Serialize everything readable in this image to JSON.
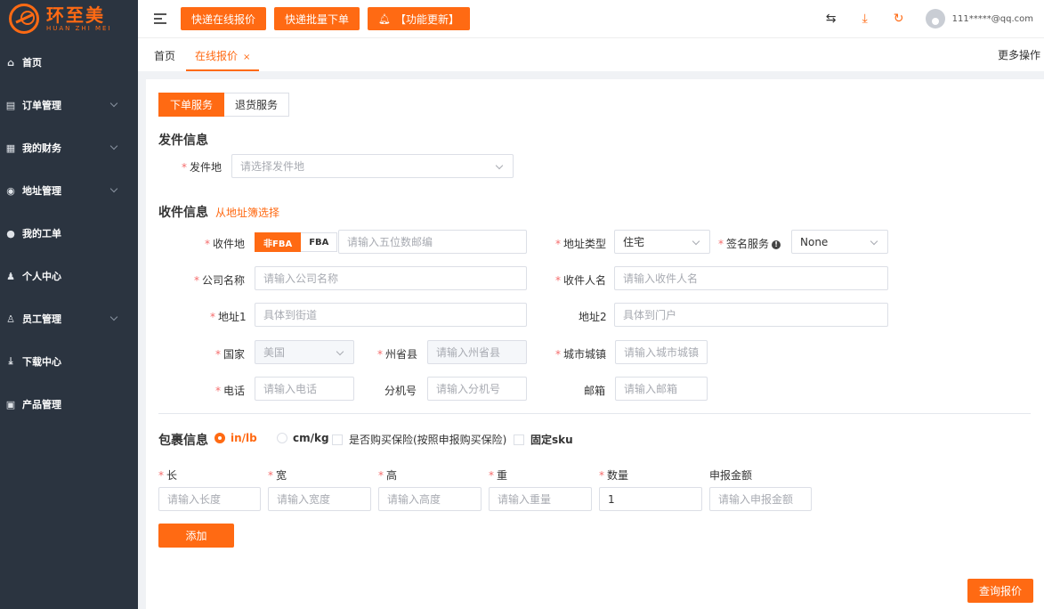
{
  "logo": {
    "cn": "环至美",
    "en": "HUAN ZHI MEI"
  },
  "sidebar": {
    "items": [
      {
        "label": "首页",
        "icon": "home-icon",
        "expandable": false
      },
      {
        "label": "订单管理",
        "icon": "order-icon",
        "expandable": true
      },
      {
        "label": "我的财务",
        "icon": "finance-icon",
        "expandable": true
      },
      {
        "label": "地址管理",
        "icon": "location-icon",
        "expandable": true
      },
      {
        "label": "我的工单",
        "icon": "ticket-icon",
        "expandable": false
      },
      {
        "label": "个人中心",
        "icon": "user-icon",
        "expandable": false
      },
      {
        "label": "员工管理",
        "icon": "staff-icon",
        "expandable": true
      },
      {
        "label": "下载中心",
        "icon": "download-icon",
        "expandable": false
      },
      {
        "label": "产品管理",
        "icon": "product-icon",
        "expandable": false
      }
    ]
  },
  "header": {
    "quick_quote": "快递在线报价",
    "bulk_order": "快递批量下单",
    "feature_update": "【功能更新】",
    "user": "111*****@qq.com"
  },
  "tabs": {
    "home": "首页",
    "active": "在线报价",
    "close": "×",
    "more": "更多操作"
  },
  "service": {
    "order": "下单服务",
    "return": "退货服务"
  },
  "sender": {
    "title": "发件信息",
    "origin_label": "发件地",
    "origin_placeholder": "请选择发件地"
  },
  "receiver": {
    "title": "收件信息",
    "pick_link": "从地址簿选择",
    "dest_label": "收件地",
    "non_fba": "非FBA",
    "fba": "FBA",
    "zip_placeholder": "请输入五位数邮编",
    "addr_type_label": "地址类型",
    "addr_type_value": "住宅",
    "sign_label": "签名服务",
    "sign_value": "None",
    "company_label": "公司名称",
    "company_placeholder": "请输入公司名称",
    "name_label": "收件人名",
    "name_placeholder": "请输入收件人名",
    "addr1_label": "地址1",
    "addr1_placeholder": "具体到街道",
    "addr2_label": "地址2",
    "addr2_placeholder": "具体到门户",
    "country_label": "国家",
    "country_value": "美国",
    "state_label": "州省县",
    "state_placeholder": "请输入州省县",
    "city_label": "城市城镇",
    "city_placeholder": "请输入城市城镇",
    "phone_label": "电话",
    "phone_placeholder": "请输入电话",
    "ext_label": "分机号",
    "ext_placeholder": "请输入分机号",
    "email_label": "邮箱",
    "email_placeholder": "请输入邮箱"
  },
  "package": {
    "title": "包裹信息",
    "unit_inlb": "in/lb",
    "unit_cmkg": "cm/kg",
    "insurance": "是否购买保险(按照申报购买保险)",
    "fixed_sku": "固定sku",
    "length_label": "长",
    "length_placeholder": "请输入长度",
    "width_label": "宽",
    "width_placeholder": "请输入宽度",
    "height_label": "高",
    "height_placeholder": "请输入高度",
    "weight_label": "重",
    "weight_placeholder": "请输入重量",
    "qty_label": "数量",
    "qty_value": "1",
    "declared_label": "申报金额",
    "declared_placeholder": "请输入申报金额",
    "add": "添加"
  },
  "query_button": "查询报价",
  "colors": {
    "accent": "#ff6a13",
    "sidebar_bg": "#2b3440",
    "required": "#f56c6c"
  }
}
